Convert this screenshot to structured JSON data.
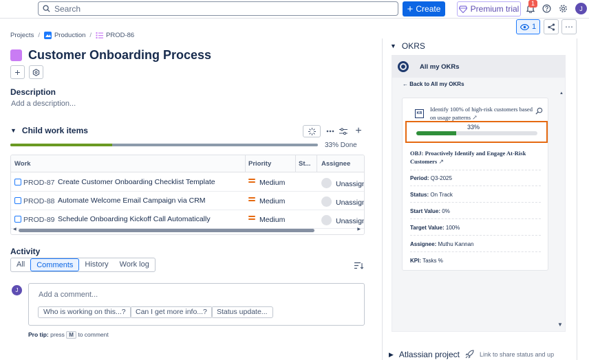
{
  "topbar": {
    "search_placeholder": "Search",
    "create_label": "Create",
    "premium_label": "Premium trial",
    "notification_count": "1",
    "avatar_initial": "J"
  },
  "breadcrumb": {
    "items": [
      "Projects",
      "Production",
      "PROD-86"
    ]
  },
  "issue": {
    "title": "Customer Onboarding Process"
  },
  "description": {
    "heading": "Description",
    "placeholder": "Add a description..."
  },
  "child_items": {
    "heading": "Child work items",
    "progress_fraction": 0.33,
    "done_text": "33% Done",
    "columns": [
      "Work",
      "Priority",
      "St...",
      "Assignee"
    ],
    "rows": [
      {
        "key": "PROD-87",
        "summary": "Create Customer Onboarding Checklist Template",
        "priority": "Medium",
        "assignee": "Unassign"
      },
      {
        "key": "PROD-88",
        "summary": "Automate Welcome Email Campaign via CRM",
        "priority": "Medium",
        "assignee": "Unassign"
      },
      {
        "key": "PROD-89",
        "summary": "Schedule Onboarding Kickoff Call Automatically",
        "priority": "Medium",
        "assignee": "Unassign"
      }
    ]
  },
  "activity": {
    "heading": "Activity",
    "tabs": [
      "All",
      "Comments",
      "History",
      "Work log"
    ],
    "active_tab": "Comments",
    "comment_placeholder": "Add a comment...",
    "suggestions": [
      "Who is working on this...?",
      "Can I get more info...?",
      "Status update..."
    ],
    "protip_label": "Pro tip:",
    "protip_press": "press",
    "protip_key": "M",
    "protip_rest": "to comment",
    "avatar_initial": "J"
  },
  "right_panel": {
    "watch_count": "1",
    "okrs_heading": "OKRS",
    "okr_app_title": "All my OKRs",
    "back_label": "Back to All my OKRs",
    "kr_icon_label": "KR",
    "key_result": "Identify 100% of high-risk customers based on usage patterns",
    "kr_progress_text": "33%",
    "kr_progress_fraction": 0.33,
    "objective_label": "OBJ:",
    "objective": "Proactively Identify and Engage At-Risk Customers",
    "fields": [
      {
        "label": "Period:",
        "value": "Q3-2025"
      },
      {
        "label": "Status:",
        "value": "On Track"
      },
      {
        "label": "Start Value:",
        "value": "0%"
      },
      {
        "label": "Target Value:",
        "value": "100%"
      },
      {
        "label": "Assignee:",
        "value": "Muthu Kannan"
      },
      {
        "label": "KPI:",
        "value": "Tasks %"
      }
    ],
    "bottom_section": "Atlassian project",
    "bottom_hint": "Link to share status and upd"
  },
  "colors": {
    "primary": "#0c66e4",
    "progress_done": "#6a9a23",
    "kr_fill": "#2f8f3a",
    "highlight_box": "#e56910",
    "title_square": "#c97cf4"
  }
}
